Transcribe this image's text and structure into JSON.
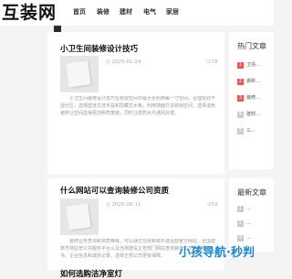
{
  "site": {
    "logo": "互装网"
  },
  "nav": [
    "首页",
    "装修",
    "建材",
    "电气",
    "家居"
  ],
  "articles": [
    {
      "title": "小卫生间装修设计技巧",
      "date": "2025-01-24",
      "tag": "78",
      "body": "小卫生间装修设计技巧在有限空间中最大化利用每一寸空间，合理规划干湿分区，选择壁挂式洗手盆和隐藏式水箱，利用墙面打造收纳空间，选择浅色瓷砖让空间显得更加明亮宽敞，同时注意防水与通风处理。"
    },
    {
      "title": "什么网站可以查询装修公司资质",
      "date": "2025-06-11",
      "tag": "53",
      "body": "装修业务查询和资质等级，可以通过住房和城乡建设部官方网站、全国建筑市场监管公共服务平台以及当地建设主管部门网站查询装修公司的资质证书、企业信息和诚信记录，选择正规公司更有保障。"
    },
    {
      "title": "如何选购洁净室灯",
      "date": "",
      "tag": "",
      "body": ""
    }
  ],
  "sidebar": {
    "hot_title": "热门文章",
    "hot_items": [
      {
        "num": "1",
        "text": "卫浴…"
      },
      {
        "num": "2",
        "text": "瓷砖…"
      },
      {
        "num": "3",
        "text": "装修…"
      },
      {
        "num": "4",
        "text": "建材…"
      },
      {
        "num": "5",
        "text": "三…"
      }
    ],
    "latest_title": "最新文章",
    "latest_items": [
      {
        "num": "1",
        "text": "…"
      },
      {
        "num": "2",
        "text": "…"
      },
      {
        "num": "3",
        "text": "…"
      }
    ]
  },
  "watermark": "小孩导航·秒判",
  "colors": {
    "accent": "#e55555",
    "watermark": "#1e88d3"
  }
}
